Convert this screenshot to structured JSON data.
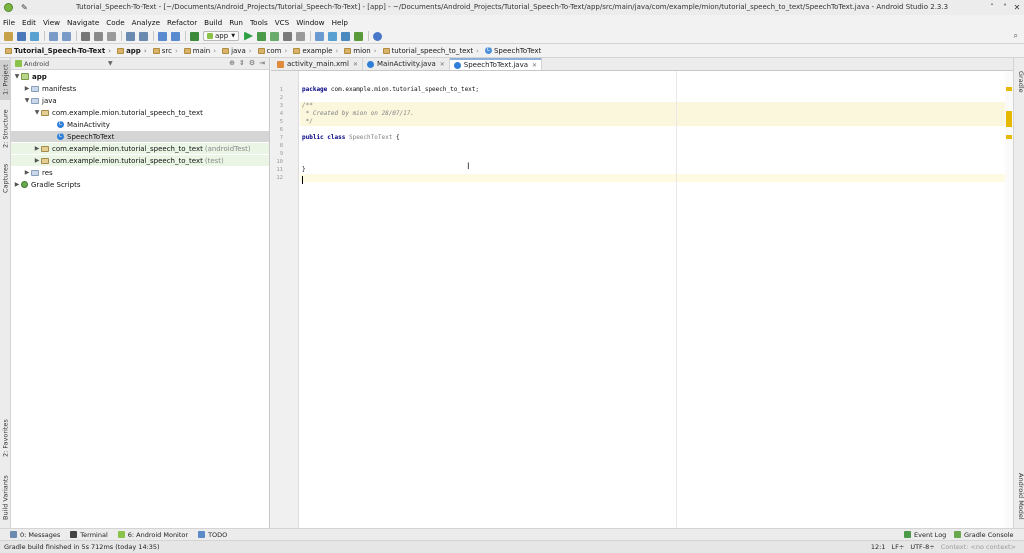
{
  "window": {
    "title": "Tutorial_Speech-To-Text - [~/Documents/Android_Projects/Tutorial_Speech-To-Text] - [app] - ~/Documents/Android_Projects/Tutorial_Speech-To-Text/app/src/main/java/com/example/mion/tutorial_speech_to_text/SpeechToText.java - Android Studio 2.3.3",
    "controls": [
      "ˇ",
      "˄",
      "✕"
    ]
  },
  "menu": [
    "File",
    "Edit",
    "View",
    "Navigate",
    "Code",
    "Analyze",
    "Refactor",
    "Build",
    "Run",
    "Tools",
    "VCS",
    "Window",
    "Help"
  ],
  "toolbar": {
    "run_config": "app"
  },
  "breadcrumbs": [
    {
      "label": "Tutorial_Speech-To-Text",
      "bold": true,
      "type": "folder"
    },
    {
      "label": "app",
      "bold": true,
      "type": "folder"
    },
    {
      "label": "src",
      "type": "folder"
    },
    {
      "label": "main",
      "type": "folder"
    },
    {
      "label": "java",
      "type": "folder"
    },
    {
      "label": "com",
      "type": "folder"
    },
    {
      "label": "example",
      "type": "folder"
    },
    {
      "label": "mion",
      "type": "folder"
    },
    {
      "label": "tutorial_speech_to_text",
      "type": "folder"
    },
    {
      "label": "SpeechToText",
      "type": "class"
    }
  ],
  "left_tabs": {
    "project": "1: Project",
    "structure": "2: Structure",
    "captures": "Captures",
    "favorites": "2: Favorites",
    "build_variants": "Build Variants"
  },
  "right_tabs": {
    "gradle": "Gradle",
    "android_model": "Android Model"
  },
  "project_panel": {
    "view_mode": "Android",
    "tree": {
      "app": "app",
      "manifests": "manifests",
      "java": "java",
      "pkg_main": "com.example.mion.tutorial_speech_to_text",
      "main_activity": "MainActivity",
      "speech_to_text": "SpeechToText",
      "pkg_android_test": "com.example.mion.tutorial_speech_to_text",
      "android_test_suffix": "(androidTest)",
      "pkg_test": "com.example.mion.tutorial_speech_to_text",
      "test_suffix": "(test)",
      "res": "res",
      "gradle_scripts": "Gradle Scripts"
    }
  },
  "editor": {
    "tabs": [
      {
        "label": "activity_main.xml",
        "type": "xml",
        "active": false
      },
      {
        "label": "MainActivity.java",
        "type": "class",
        "active": false
      },
      {
        "label": "SpeechToText.java",
        "type": "class",
        "active": true
      }
    ],
    "line_numbers": [
      "1",
      "2",
      "3",
      "4",
      "5",
      "6",
      "7",
      "8",
      "9",
      "10",
      "11",
      "12"
    ],
    "code": {
      "l1_kw": "package",
      "l1_rest": " com.example.mion.tutorial_speech_to_text;",
      "l3": "/**",
      "l4": " * Created by mion on 28/07/17.",
      "l5": " */",
      "l7_kw": "public class",
      "l7_name": " SpeechToText",
      "l7_brace": " {",
      "l11": "}"
    }
  },
  "bottom_tabs": {
    "messages": "0: Messages",
    "terminal": "Terminal",
    "android_monitor": "6: Android Monitor",
    "todo": "TODO",
    "event_log": "Event Log",
    "gradle_console": "Gradle Console"
  },
  "status": {
    "message": "Gradle build finished in 5s 712ms (today 14:35)",
    "position": "12:1",
    "line_sep": "LF÷",
    "encoding": "UTF-8÷",
    "context": "Context: <no context>"
  },
  "colors": {
    "accent_green": "#8bc34a",
    "class_blue": "#2f7ed8",
    "marker_yellow": "#e6b800"
  }
}
